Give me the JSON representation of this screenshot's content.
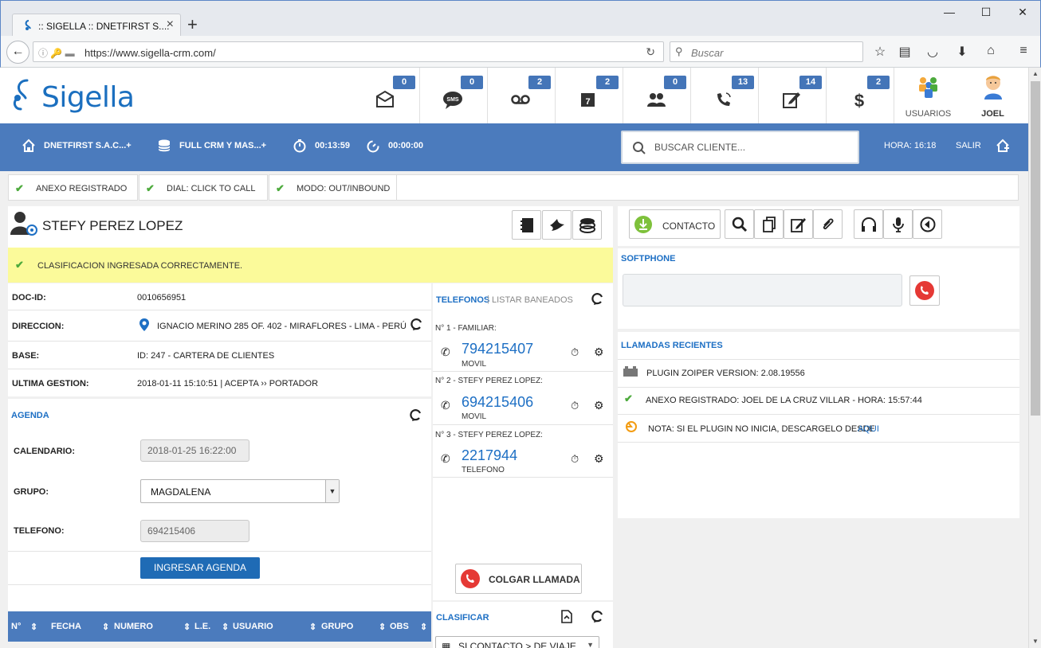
{
  "browser": {
    "tab_title": ":: SIGELLA :: DNETFIRST S....",
    "url": "https://www.sigella-crm.com/",
    "search_placeholder": "Buscar"
  },
  "brand": {
    "name": "Sigella",
    "color": "#1b6fbf"
  },
  "header": {
    "counters": [
      {
        "icon": "envelope-icon",
        "count": "0"
      },
      {
        "icon": "sms-icon",
        "count": "0"
      },
      {
        "icon": "voicemail-icon",
        "count": "2"
      },
      {
        "icon": "calendar-icon",
        "count": "2"
      },
      {
        "icon": "contacts-icon",
        "count": "0"
      },
      {
        "icon": "phone-call-icon",
        "count": "13"
      },
      {
        "icon": "edit-note-icon",
        "count": "14"
      },
      {
        "icon": "dollar-icon",
        "count": "2"
      }
    ],
    "users_label": "USUARIOS",
    "user_label": "JOEL"
  },
  "bluebar": {
    "company": "DNETFIRST S.A.C...+",
    "database": "FULL CRM Y MAS...+",
    "timer1": "00:13:59",
    "timer2": "00:00:00",
    "search_placeholder": "BUSCAR CLIENTE...",
    "hora": "HORA: 16:18",
    "salir": "SALIR",
    "accent": "#4b7bbd"
  },
  "status": [
    {
      "label": "ANEXO REGISTRADO"
    },
    {
      "label": "DIAL: CLICK TO CALL"
    },
    {
      "label": "MODO: OUT/INBOUND"
    }
  ],
  "client": {
    "name": "STEFY PEREZ LOPEZ",
    "alert": "CLASIFICACION INGRESADA CORRECTAMENTE.",
    "fields": [
      {
        "label": "DOC-ID:",
        "value": "0010656951"
      },
      {
        "label": "DIRECCION:",
        "value": "IGNACIO MERINO 285 OF. 402 - MIRAFLORES - LIMA - PERÚ"
      },
      {
        "label": "BASE:",
        "value": "ID: 247 - CARTERA DE CLIENTES"
      },
      {
        "label": "ULTIMA GESTION:",
        "value": "2018-01-11 15:10:51 | ACEPTA ›› PORTADOR"
      }
    ]
  },
  "agenda": {
    "title": "AGENDA",
    "calendario_label": "CALENDARIO:",
    "calendario_value": "2018-01-25 16:22:00",
    "grupo_label": "GRUPO:",
    "grupo_value": "MAGDALENA",
    "telefono_label": "TELEFONO:",
    "telefono_value": "694215406",
    "submit_label": "INGRESAR AGENDA",
    "table_headers": [
      "N°",
      "FECHA",
      "NUMERO",
      "L.E.",
      "USUARIO",
      "GRUPO",
      "OBS"
    ]
  },
  "telefonos": {
    "title": "TELEFONOS",
    "separator": "|",
    "banned_link": "LISTAR BANEADOS",
    "items": [
      {
        "title": "N° 1 - FAMILIAR:",
        "number": "794215407",
        "type": "MOVIL"
      },
      {
        "title": "N° 2 - STEFY PEREZ LOPEZ:",
        "number": "694215406",
        "type": "MOVIL"
      },
      {
        "title": "N° 3 - STEFY PEREZ LOPEZ:",
        "number": "2217944",
        "type": "TELEFONO"
      }
    ],
    "hangup_label": "COLGAR LLAMADA"
  },
  "clasificar": {
    "title": "CLASIFICAR",
    "select_value": "SI CONTACTO > DE VIAJE"
  },
  "right": {
    "contacto_label": "CONTACTO",
    "softphone_title": "SOFTPHONE",
    "recent_title": "LLAMADAS RECIENTES",
    "log": [
      {
        "icon": "plugin-icon",
        "text": "PLUGIN ZOIPER VERSION: 2.08.19556"
      },
      {
        "icon": "check-icon",
        "text": "ANEXO REGISTRADO: JOEL DE LA CRUZ VILLAR - HORA: 15:57:44"
      },
      {
        "icon": "info-icon",
        "text": "NOTA: SI EL PLUGIN NO INICIA, DESCARGELO DESDE",
        "link": "AQUI"
      }
    ]
  },
  "colors": {
    "link_blue": "#1d6fc4",
    "alert_bg": "#fbfa9a",
    "call_red": "#e53935",
    "check_green": "#4caa3c"
  }
}
